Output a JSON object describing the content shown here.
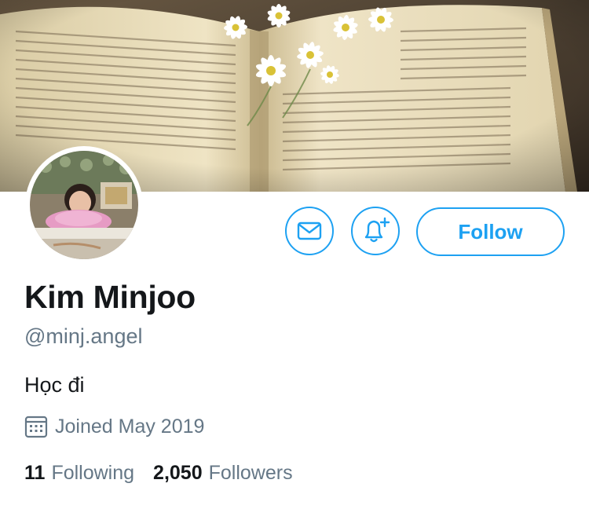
{
  "profile": {
    "display_name": "Kim Minjoo",
    "handle": "@minj.angel",
    "bio": "Học đi",
    "joined": "Joined May 2019"
  },
  "actions": {
    "follow_label": "Follow",
    "message_icon": "envelope-icon",
    "notify_icon": "bell-plus-icon"
  },
  "stats": {
    "following_count": "11",
    "following_label": "Following",
    "followers_count": "2,050",
    "followers_label": "Followers"
  },
  "colors": {
    "accent": "#1da1f2",
    "text_primary": "#14171a",
    "text_secondary": "#657786"
  }
}
